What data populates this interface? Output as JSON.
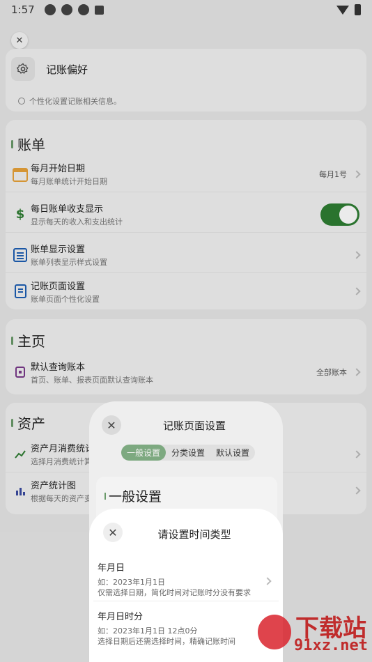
{
  "status_bar": {
    "time": "1:57"
  },
  "preferences": {
    "title": "记账偏好",
    "info": "个性化设置记账相关信息。"
  },
  "bills": {
    "section_title": "账单",
    "items": [
      {
        "title": "每月开始日期",
        "subtitle": "每月账单统计开始日期",
        "value": "每月1号"
      },
      {
        "title": "每日账单收支显示",
        "subtitle": "显示每天的收入和支出统计"
      },
      {
        "title": "账单显示设置",
        "subtitle": "账单列表显示样式设置"
      },
      {
        "title": "记账页面设置",
        "subtitle": "账单页面个性化设置"
      }
    ]
  },
  "home": {
    "section_title": "主页",
    "items": [
      {
        "title": "默认查询账本",
        "subtitle": "首页、账单、报表页面默认查询账本",
        "value": "全部账本"
      }
    ]
  },
  "assets": {
    "section_title": "资产",
    "items": [
      {
        "title": "资产月消费统计",
        "subtitle": "选择月消费统计算"
      },
      {
        "title": "资产统计图",
        "subtitle": "根据每天的资产变"
      }
    ]
  },
  "page_settings_sheet": {
    "title": "记账页面设置",
    "tabs": [
      "一般设置",
      "分类设置",
      "默认设置"
    ],
    "section_title": "一般设置"
  },
  "time_type_sheet": {
    "title": "请设置时间类型",
    "options": [
      {
        "title": "年月日",
        "example": "如：2023年1月1日",
        "desc": "仅需选择日期，简化时间对记账时分没有要求"
      },
      {
        "title": "年月日时分",
        "example": "如：2023年1月1日 12点0分",
        "desc": "选择日期后还需选择时间，精确记账时间"
      }
    ]
  },
  "watermark": {
    "line1": "下载站",
    "line2": "91xz.net"
  },
  "colors": {
    "accent": "#2e7d32",
    "background": "#e7e7e7",
    "sheet": "#ffffff"
  }
}
